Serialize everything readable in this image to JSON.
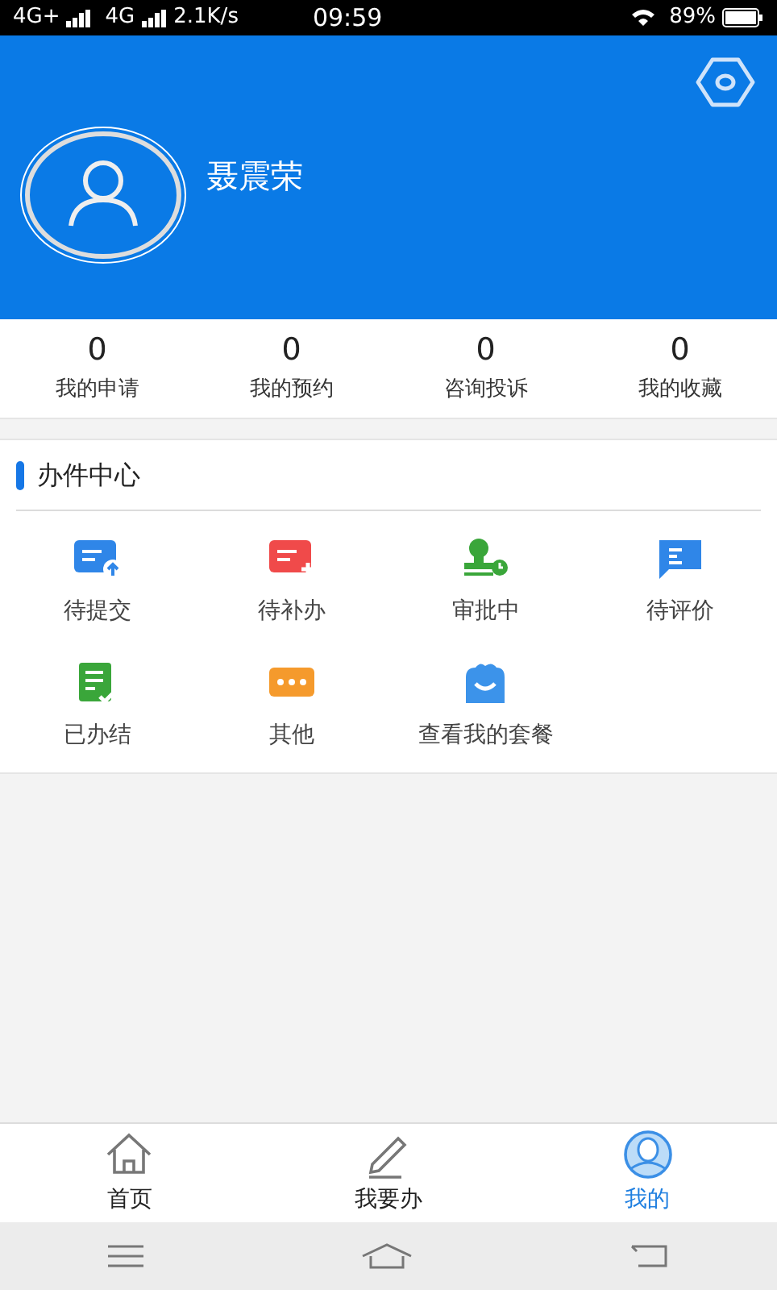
{
  "status_bar": {
    "network": "4G+",
    "network_2": "4G",
    "speed": "2.1K/s",
    "time": "09:59",
    "battery": "89%"
  },
  "profile": {
    "name": "聂震荣"
  },
  "stats": [
    {
      "value": "0",
      "label": "我的申请"
    },
    {
      "value": "0",
      "label": "我的预约"
    },
    {
      "value": "0",
      "label": "咨询投诉"
    },
    {
      "value": "0",
      "label": "我的收藏"
    }
  ],
  "section": {
    "title": "办件中心",
    "items": [
      {
        "kind": "submit",
        "label": "待提交"
      },
      {
        "kind": "supplement",
        "label": "待补办"
      },
      {
        "kind": "approving",
        "label": "审批中"
      },
      {
        "kind": "review",
        "label": "待评价"
      },
      {
        "kind": "done",
        "label": "已办结"
      },
      {
        "kind": "other",
        "label": "其他"
      },
      {
        "kind": "package",
        "label": "查看我的套餐"
      }
    ]
  },
  "tabs": [
    {
      "kind": "home",
      "label": "首页",
      "selected": false
    },
    {
      "kind": "todo",
      "label": "我要办",
      "selected": false
    },
    {
      "kind": "mine",
      "label": "我的",
      "selected": true
    }
  ]
}
